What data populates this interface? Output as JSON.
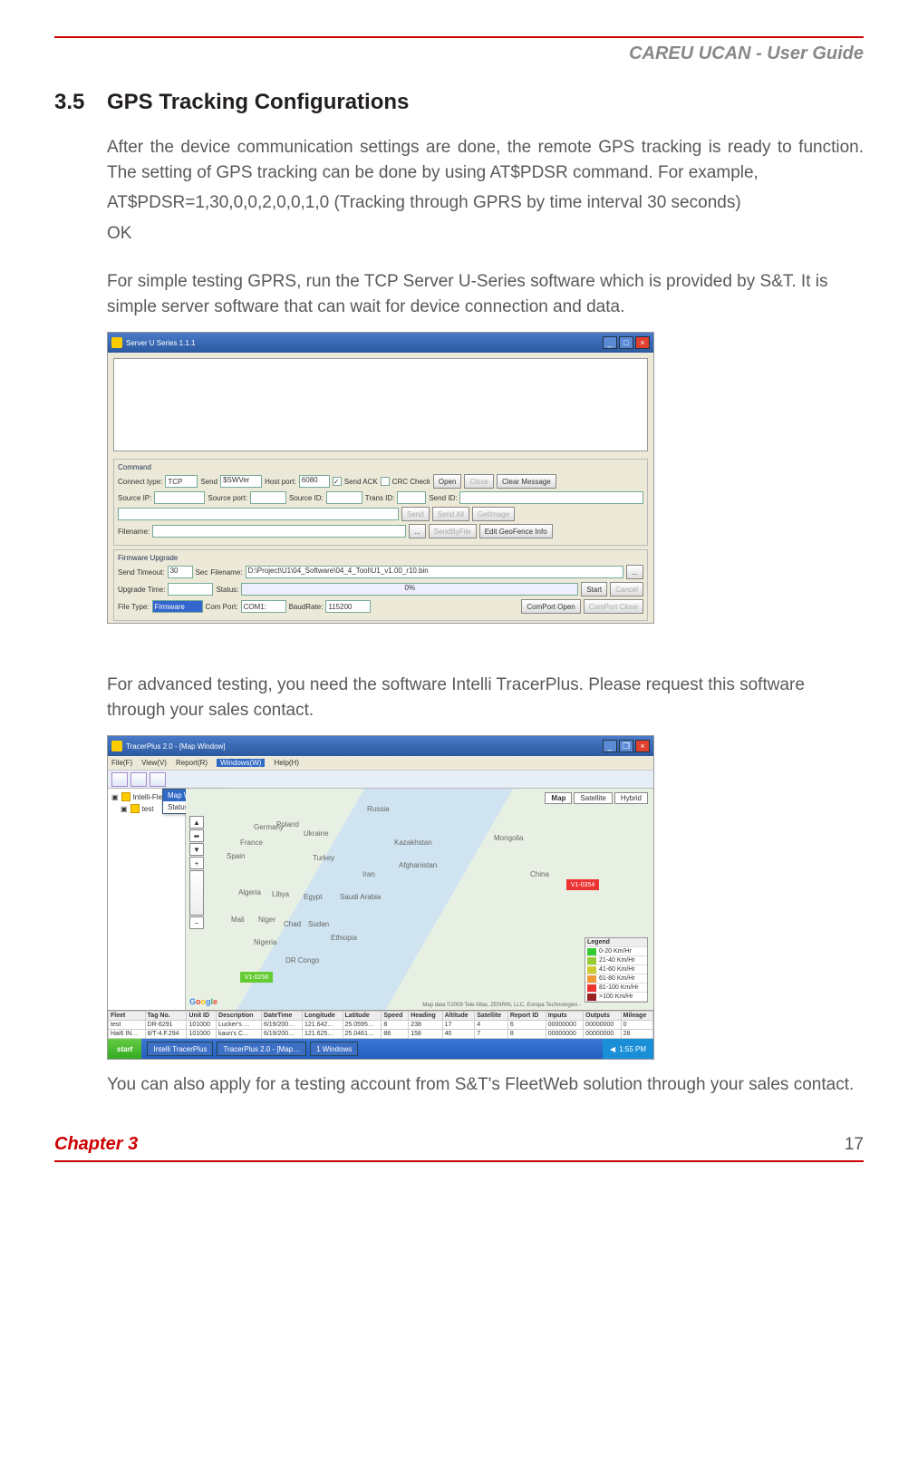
{
  "header": {
    "guide_title": "CAREU UCAN - User Guide"
  },
  "section": {
    "number": "3.5",
    "title": "GPS Tracking Configurations"
  },
  "body": {
    "p1": "After the device communication settings are done, the remote GPS tracking is ready to function. The setting of GPS tracking can be done by using AT$PDSR command. For example,",
    "p2": "AT$PDSR=1,30,0,0,2,0,0,1,0 (Tracking through GPRS by time interval 30 seconds)",
    "p3": "OK",
    "p4": "For simple testing GPRS, run the TCP Server U-Series software which is provided by S&T. It is simple server software that can wait for device connection and data.",
    "p5": "For advanced testing, you need the software Intelli TracerPlus. Please request this software through your sales contact.",
    "p6": "You can also apply for a testing account from S&T's FleetWeb solution through your  sales contact."
  },
  "app1": {
    "title": "Server U Series 1.1.1",
    "panels": {
      "command": "Command",
      "firmware": "Firmware Upgrade"
    },
    "labels": {
      "connect_type": "Connect type:",
      "send": "Send",
      "host_port": "Host port:",
      "send_ack": "Send ACK",
      "crc_check": "CRC Check",
      "source_ip": "Source IP:",
      "source_port": "Source port:",
      "source_id": "Source ID:",
      "trans_id": "Trans ID:",
      "send_id": "Send ID:",
      "filename": "Filename:",
      "send_timeout": "Send Timeout:",
      "sec": "Sec",
      "filename2": "Filename:",
      "upgrade_time": "Upgrade Time:",
      "status": "Status:",
      "file_type": "File Type:",
      "com_port": "Com Port:",
      "baudrate": "BaudRate:"
    },
    "values": {
      "connect_type": "TCP",
      "send_val": "$SWVer",
      "host_port": "6080",
      "send_timeout": "30",
      "firmware_path": "D:\\Project\\U1\\04_Software\\04_4_Tool\\U1_v1.00_r10.bin",
      "status_val": "0%",
      "file_type": "Firmware",
      "com_port": "COM1:",
      "baudrate": "115200"
    },
    "buttons": {
      "open": "Open",
      "close": "Close",
      "clear_message": "Clear Message",
      "send_btn": "Send",
      "send_all": "Send All",
      "get_image": "GetImage",
      "browse": "...",
      "send_by_file": "SendByFile",
      "edit_geofence": "Edit GeoFence Info",
      "start": "Start",
      "cancel": "Cancel",
      "comport_open": "ComPort Open",
      "comport_close": "ComPort Close"
    }
  },
  "app2": {
    "title": "TracerPlus 2.0 - [Map Window]",
    "menu": {
      "file": "File(F)",
      "view": "View(V)",
      "report": "Report(R)",
      "windows": "Windows(W)",
      "help": "Help(H)"
    },
    "dropdown": {
      "map_window": "Map Window",
      "status": "Status"
    },
    "tree": {
      "root": "Intelli-Fleet",
      "child": "test"
    },
    "map_tabs": {
      "map": "Map",
      "satellite": "Satellite",
      "hybrid": "Hybrid"
    },
    "map_labels": {
      "russia": "Russia",
      "kazakhstan": "Kazakhstan",
      "mongolia": "Mongolia",
      "china": "China",
      "iran": "Iran",
      "afghanistan": "Afghanistan",
      "saudi": "Saudi Arabia",
      "algeria": "Algeria",
      "libya": "Libya",
      "egypt": "Egypt",
      "sudan": "Sudan",
      "mali": "Mali",
      "niger": "Niger",
      "chad": "Chad",
      "nigeria": "Nigeria",
      "drcongo": "DR Congo",
      "ethiopia": "Ethiopia",
      "france": "France",
      "spain": "Spain",
      "turkey": "Turkey",
      "ukraine": "Ukraine",
      "poland": "Poland",
      "germany": "Germany"
    },
    "legend": {
      "title": "Legend",
      "r1": "0-20 Km/Hr",
      "r2": "21-40 Km/Hr",
      "r3": "41-60 Km/Hr",
      "r4": "61-80 Km/Hr",
      "r5": "81-100 Km/Hr",
      "r6": ">100 Km/Hr"
    },
    "pins": {
      "p1": "V1-0256",
      "p2": "V1-0354"
    },
    "attribution": "Map data ©2009 Tele Atlas, ZENRIN, LLC, Europa Technologies -",
    "table": {
      "headers": [
        "Fleet",
        "Tag No.",
        "Unit ID",
        "Description",
        "DateTime",
        "Longitude",
        "Latitude",
        "Speed",
        "Heading",
        "Altitude",
        "Satellite",
        "Report ID",
        "Inputs",
        "Outputs",
        "Mileage"
      ],
      "rows": [
        [
          "test",
          "DR-6291",
          "101000",
          "Lucker's …",
          "6/19/200…",
          "121.642…",
          "25.0595…",
          "8",
          "238",
          "17",
          "4",
          "6",
          "00000000",
          "00000000",
          "0"
        ],
        [
          "Hai6 IN…",
          "8/T-4.F.294",
          "101000",
          "kaun's C…",
          "6/19/200…",
          "121.625…",
          "25.0461…",
          "88",
          "158",
          "40",
          "7",
          "8",
          "00000000",
          "00000000",
          "28"
        ]
      ]
    },
    "taskbar": {
      "start": "start",
      "items": [
        "Intelli TracerPlus",
        "TracerPlus 2.0 - [Map…",
        "1 Windows"
      ],
      "time": "1:55 PM"
    }
  },
  "footer": {
    "chapter": "Chapter 3",
    "page": "17"
  }
}
